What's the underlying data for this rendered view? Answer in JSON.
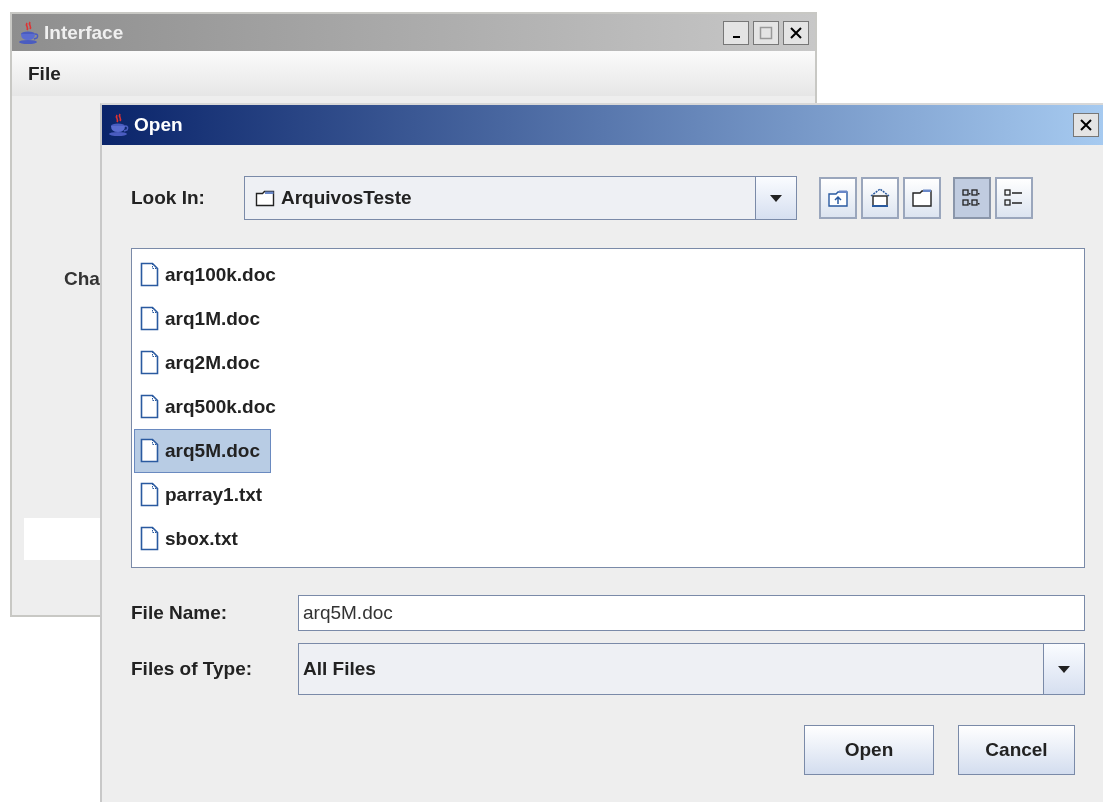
{
  "main_window": {
    "title": "Interface",
    "menu": [
      {
        "label": "File"
      }
    ],
    "label": "Cha"
  },
  "dialog": {
    "title": "Open",
    "look_in": {
      "label": "Look In:",
      "value": "ArquivosTeste"
    },
    "toolbar": [
      {
        "kind": "up-folder",
        "selected": false
      },
      {
        "kind": "home",
        "selected": false
      },
      {
        "kind": "new-folder",
        "selected": false
      },
      {
        "kind": "list-view",
        "selected": true
      },
      {
        "kind": "details-view",
        "selected": false
      }
    ],
    "files": [
      {
        "name": "arq100k.doc",
        "selected": false
      },
      {
        "name": "arq1M.doc",
        "selected": false
      },
      {
        "name": "arq2M.doc",
        "selected": false
      },
      {
        "name": "arq500k.doc",
        "selected": false
      },
      {
        "name": "arq5M.doc",
        "selected": true
      },
      {
        "name": "parray1.txt",
        "selected": false
      },
      {
        "name": "sbox.txt",
        "selected": false
      }
    ],
    "file_name": {
      "label": "File Name:",
      "value": "arq5M.doc"
    },
    "file_type": {
      "label": "Files of Type:",
      "value": "All Files"
    },
    "buttons": [
      "Open",
      "Cancel"
    ]
  }
}
